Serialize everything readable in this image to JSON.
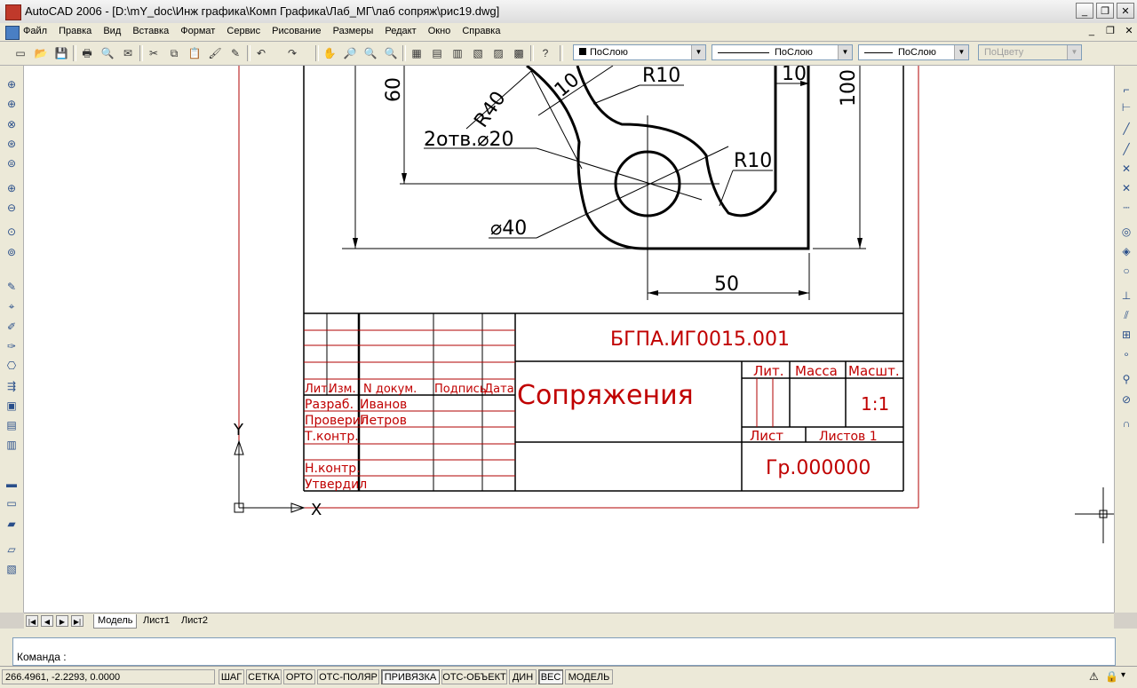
{
  "window": {
    "title": "AutoCAD 2006 - [D:\\mY_doc\\Инж графика\\Комп Графика\\Лаб_МГ\\лаб сопряж\\рис19.dwg]",
    "minimize_glyph": "_",
    "maximize_glyph": "❐",
    "close_glyph": "✕"
  },
  "menu": {
    "items": [
      "Файл",
      "Правка",
      "Вид",
      "Вставка",
      "Формат",
      "Сервис",
      "Рисование",
      "Размеры",
      "Редакт",
      "Окно",
      "Справка"
    ],
    "mdi_glyphs": [
      "_",
      "❐",
      "✕"
    ]
  },
  "properties": {
    "layer": "ПоСлою",
    "linetype": "ПоСлою",
    "lineweight": "ПоСлою",
    "plotstyle": "ПоЦвету"
  },
  "drawing": {
    "dims": {
      "d60": "60",
      "r40": "R40",
      "d10a": "10",
      "r10a": "R10",
      "d10b": "10",
      "d100": "100",
      "holes": "2отв.⌀20",
      "r10b": "R10",
      "dia40": "⌀40",
      "d50": "50"
    },
    "ucs": {
      "x": "X",
      "y": "Y"
    },
    "title_block": {
      "code": "БГПА.ИГ0015.001",
      "name": "Сопряжения",
      "lit_header": "Лит.",
      "mass_header": "Масса",
      "scale_header": "Масшт.",
      "scale": "1:1",
      "sheet": "Лист",
      "sheets": "Листов 1",
      "group": "Гр.000000",
      "col_lit": "Лит.",
      "col_izm": "Изм.",
      "col_doc": "N докум.",
      "col_sign": "Подпись",
      "col_date": "Дата",
      "developer_role": "Разраб.",
      "developer_name": "Иванов",
      "checker_role": "Проверил",
      "checker_name": "Петров",
      "tcontrol": "Т.контр.",
      "ncontrol": "Н.контр.",
      "approved": "Утвердил"
    }
  },
  "tabs": {
    "items": [
      "Модель",
      "Лист1",
      "Лист2"
    ]
  },
  "command": {
    "prompt": "Команда :"
  },
  "status": {
    "coords": "266.4961, -2.2293, 0.0000",
    "buttons": [
      "ШАГ",
      "СЕТКА",
      "ОРТО",
      "ОТС-ПОЛЯР",
      "ПРИВЯЗКА",
      "ОТС-ОБЪЕКТ",
      "ДИН",
      "ВЕС",
      "МОДЕЛЬ"
    ]
  },
  "colors": {
    "title_red": "#c00000",
    "frame_red": "#b00000"
  }
}
